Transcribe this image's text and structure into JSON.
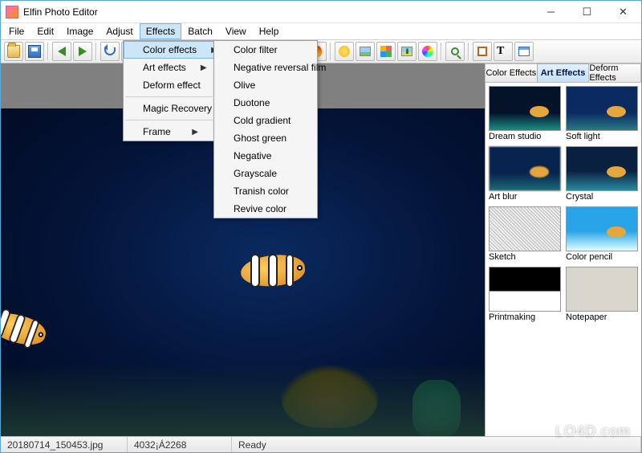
{
  "window": {
    "title": "Elfin Photo Editor"
  },
  "menubar": [
    "File",
    "Edit",
    "Image",
    "Adjust",
    "Effects",
    "Batch",
    "View",
    "Help"
  ],
  "menubar_open_index": 4,
  "effects_menu": {
    "items": [
      {
        "label": "Color effects",
        "submenu": true,
        "highlight": true
      },
      {
        "label": "Art effects",
        "submenu": true
      },
      {
        "label": "Deform effect",
        "submenu": true
      },
      {
        "sep": true
      },
      {
        "label": "Magic Recovery"
      },
      {
        "sep": true
      },
      {
        "label": "Frame",
        "submenu": true
      }
    ]
  },
  "color_effects_submenu": [
    "Color filter",
    "Negative reversal film",
    "Olive",
    "Duotone",
    "Cold gradient",
    "Ghost green",
    "Negative",
    "Grayscale",
    "Tranish color",
    "Revive color"
  ],
  "side_panel": {
    "tabs": [
      "Color Effects",
      "Art Effects",
      "Deform Effects"
    ],
    "active_tab": 1,
    "thumbs": [
      {
        "label": "Dream studio",
        "cls": "th-dream"
      },
      {
        "label": "Soft light",
        "cls": "th-soft"
      },
      {
        "label": "Art blur",
        "cls": "th-blur"
      },
      {
        "label": "Crystal",
        "cls": "th-crystal"
      },
      {
        "label": "Sketch",
        "cls": "th-sketch"
      },
      {
        "label": "Color pencil",
        "cls": "th-pencil"
      },
      {
        "label": "Printmaking",
        "cls": "th-print"
      },
      {
        "label": "Notepaper",
        "cls": "th-note"
      }
    ]
  },
  "toolbar_icons": [
    "open",
    "save",
    "|",
    "arrow-l",
    "arrow-r",
    "|",
    "undo",
    "redo",
    "|",
    "crop",
    "resize",
    "|",
    "rot-l",
    "rot-r",
    "flip-h",
    "flip-v",
    "|",
    "bc",
    "fire",
    "|",
    "sun",
    "photo",
    "grid",
    "palm",
    "wheel",
    "|",
    "zoom",
    "|",
    "frame",
    "text",
    "window"
  ],
  "status": {
    "filename": "20180714_150453.jpg",
    "dims": "4032¡Á2268",
    "state": "Ready"
  },
  "watermark": "LO4D.com"
}
